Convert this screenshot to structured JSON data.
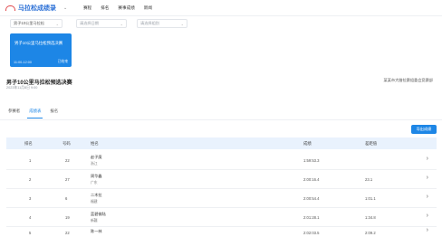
{
  "app": {
    "title": "马拉松成绩录",
    "nav": [
      "赛程",
      "排名",
      "赛事成绩",
      "新闻"
    ]
  },
  "filters": {
    "event_select": "男子10公里马拉松",
    "date_select": "请选择日期",
    "category_select": "请选择组别"
  },
  "active_card": {
    "title": "男子10公里马拉松预选决赛",
    "time": "11:00-12:00",
    "status": "已结束"
  },
  "race": {
    "title": "男子10公里马拉松预选决赛",
    "date": "2023年11月8日 9:00",
    "organizer": "某某市大腊拉赛组委会竞赛部"
  },
  "tabs": [
    {
      "label": "参赛者",
      "active": false
    },
    {
      "label": "成绩表",
      "active": true
    },
    {
      "label": "报名",
      "active": false
    }
  ],
  "export_label": "导出成绩",
  "table": {
    "headers": [
      "排名",
      "号码",
      "姓名",
      "成绩",
      "差距值"
    ],
    "rows": [
      {
        "rank": "1",
        "bib": "22",
        "name": "赵子庚",
        "team": "浙江",
        "time": "1:59:53.3",
        "gap": ""
      },
      {
        "rank": "2",
        "bib": "27",
        "name": "周华鑫",
        "team": "广东",
        "time": "2:00:16.4",
        "gap": "23.1"
      },
      {
        "rank": "3",
        "bib": "6",
        "name": "二木拉",
        "team": "福建",
        "time": "2:00:54.4",
        "gap": "1:01.1"
      },
      {
        "rank": "4",
        "bib": "19",
        "name": "蓝碧佛陆",
        "team": "新疆",
        "time": "2:01:28.1",
        "gap": "1:34.8"
      },
      {
        "rank": "5",
        "bib": "22",
        "name": "陈一林",
        "team": "",
        "time": "2:02:03.5",
        "gap": "2:09.2"
      }
    ]
  }
}
